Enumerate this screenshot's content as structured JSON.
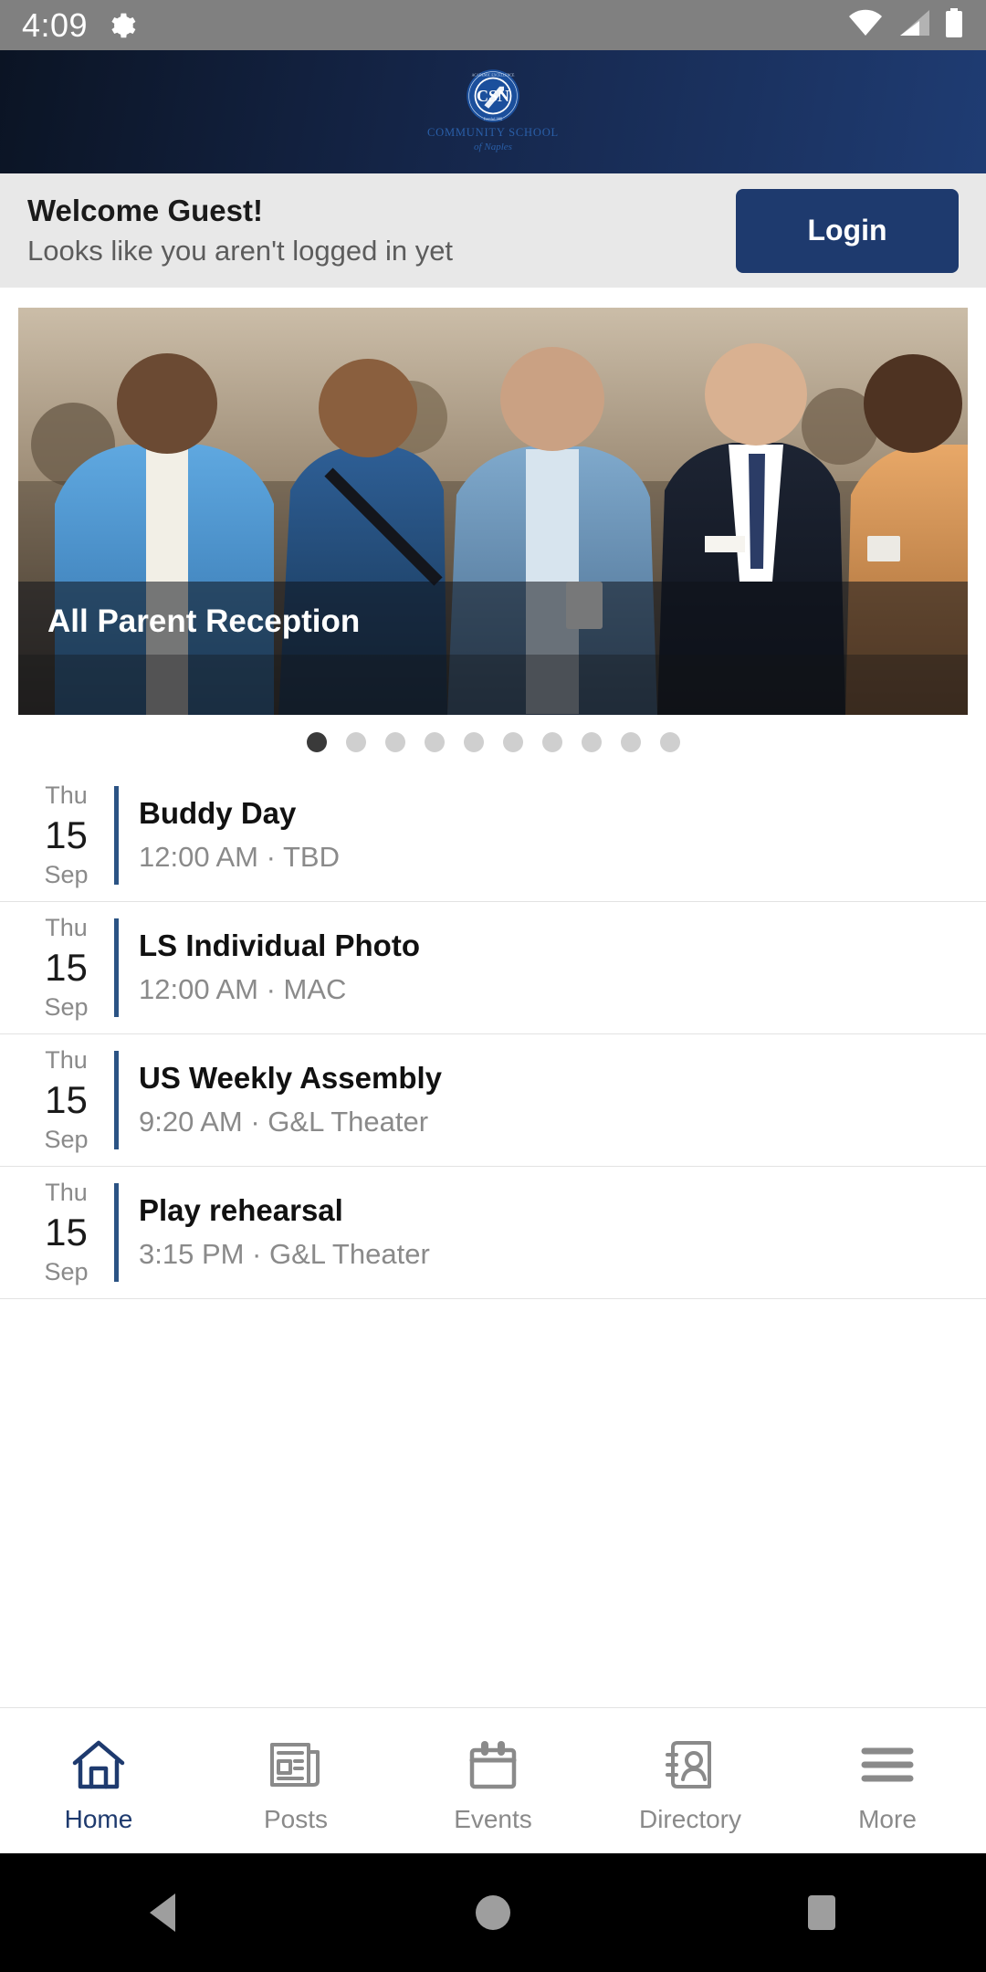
{
  "statusbar": {
    "time": "4:09",
    "icons": [
      "gear-icon",
      "wifi-icon",
      "cell-signal-icon",
      "battery-icon"
    ]
  },
  "header": {
    "logo_alt": "Community School of Naples seal",
    "logo_monogram": "CSN",
    "logo_ring_top": "ACADEMIC EXCELLENCE",
    "logo_ring_bottom": "Founded 1982",
    "school_name_line1": "COMMUNITY SCHOOL",
    "school_name_line2": "of Naples",
    "bg_color": "#15264a"
  },
  "welcome": {
    "title": "Welcome Guest!",
    "subtitle": "Looks like you aren't logged in yet",
    "login_label": "Login",
    "login_color": "#1e3a6e",
    "bar_color": "#e8e8e8"
  },
  "carousel": {
    "caption": "All Parent Reception",
    "total_slides": 10,
    "active_slide": 1,
    "active_dot_color": "#3a3a3a",
    "inactive_dot_color": "#cfcfcf"
  },
  "events": {
    "accent_color": "#2b5384",
    "items": [
      {
        "dow": "Thu",
        "day": "15",
        "month": "Sep",
        "title": "Buddy Day",
        "meta": "12:00 AM · TBD"
      },
      {
        "dow": "Thu",
        "day": "15",
        "month": "Sep",
        "title": "LS Individual Photo",
        "meta": "12:00 AM · MAC"
      },
      {
        "dow": "Thu",
        "day": "15",
        "month": "Sep",
        "title": "US Weekly Assembly",
        "meta": "9:20 AM · G&L Theater"
      },
      {
        "dow": "Thu",
        "day": "15",
        "month": "Sep",
        "title": "Play rehearsal",
        "meta": "3:15 PM · G&L Theater"
      }
    ]
  },
  "tabbar": {
    "active_color": "#1e3a6e",
    "inactive_color": "#8a8a8a",
    "tabs": [
      {
        "label": "Home",
        "icon": "home-icon",
        "active": true
      },
      {
        "label": "Posts",
        "icon": "newspaper-icon",
        "active": false
      },
      {
        "label": "Events",
        "icon": "calendar-icon",
        "active": false
      },
      {
        "label": "Directory",
        "icon": "contact-card-icon",
        "active": false
      },
      {
        "label": "More",
        "icon": "hamburger-icon",
        "active": false
      }
    ]
  },
  "androidnav": {
    "back": "back-triangle-icon",
    "home": "home-circle-icon",
    "recents": "recents-square-icon"
  }
}
